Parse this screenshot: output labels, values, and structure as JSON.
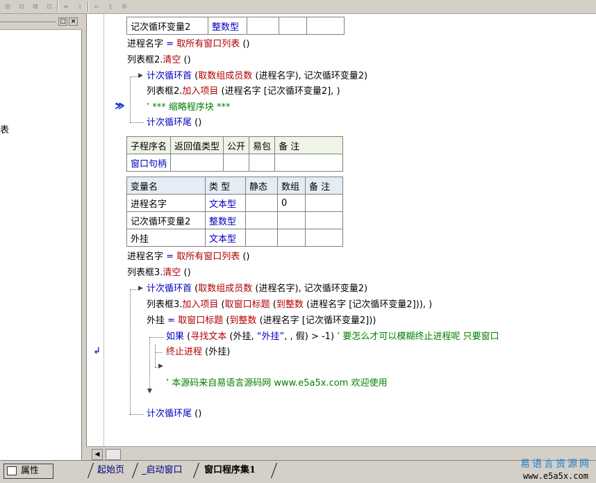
{
  "toolbar": {
    "icons": [
      "align-left-icon",
      "align-center-icon",
      "align-right-icon",
      "align-justify-icon",
      "distribute-h-icon",
      "distribute-v-icon",
      "same-width-icon",
      "same-height-icon",
      "same-size-icon"
    ]
  },
  "left_panel": {
    "pin_label": "□",
    "close_label": "×",
    "fragment": "表"
  },
  "margin": {
    "breakpoint_marker": "≫",
    "jump_marker": "↲"
  },
  "code": {
    "top_table": {
      "name": "记次循环变量2",
      "type": "整数型"
    },
    "l1": {
      "a": "进程名字",
      "b": " = ",
      "c": "取所有窗口列表",
      "d": " ()"
    },
    "l2": {
      "a": "列表框2.",
      "b": "清空",
      "c": " ()"
    },
    "l3": {
      "a": "计次循环首",
      "b": " (",
      "c": "取数组成员数",
      "d": " (进程名字), 记次循环变量2)"
    },
    "l4": {
      "a": "列表框2.",
      "b": "加入项目",
      "c": " (进程名字 [记次循环变量2], )"
    },
    "l5": {
      "a": "’ *** 缩略程序块 ***"
    },
    "l6": {
      "a": "计次循环尾",
      "b": " ()"
    },
    "sub_table": {
      "headers": [
        "子程序名",
        "返回值类型",
        "公开",
        "易包",
        "备 注"
      ],
      "row": [
        "窗口句柄",
        "",
        "",
        "",
        ""
      ]
    },
    "var_table": {
      "headers": [
        "变量名",
        "类 型",
        "静态",
        "数组",
        "备 注"
      ],
      "rows": [
        [
          "进程名字",
          "文本型",
          "",
          "0",
          ""
        ],
        [
          "记次循环变量2",
          "整数型",
          "",
          "",
          ""
        ],
        [
          "外挂",
          "文本型",
          "",
          "",
          ""
        ]
      ]
    },
    "l7": {
      "a": "进程名字",
      "b": " = ",
      "c": "取所有窗口列表",
      "d": " ()"
    },
    "l8": {
      "a": "列表框3.",
      "b": "清空",
      "c": " ()"
    },
    "l9": {
      "a": "计次循环首",
      "b": " (",
      "c": "取数组成员数",
      "d": " (进程名字), 记次循环变量2)"
    },
    "l10": {
      "a": "列表框3.",
      "b": "加入项目",
      "c": " (",
      "d": "取窗口标题",
      "e": " (",
      "f": "到整数",
      "g": " (进程名字 [记次循环变量2])), )"
    },
    "l11": {
      "a": "外挂",
      "b": " = ",
      "c": "取窗口标题",
      "d": " (",
      "e": "到整数",
      "f": " (进程名字 [记次循环变量2]))"
    },
    "l12": {
      "a": "如果",
      "b": " (",
      "c": "寻找文本",
      "d": " (外挂, ",
      "e": "“外挂”",
      "f": ", , 假) > -1) ",
      "g": "’ 要怎么才可以模糊终止进程呢 只要窗口"
    },
    "l13": {
      "a": "终止进程",
      "b": " (外挂)"
    },
    "l14": {
      "a": "’ 本源码来自易语言源码网 www.e5a5x.com  欢迎使用"
    },
    "l15": {
      "a": "计次循环尾",
      "b": " ()"
    }
  },
  "hscroll": {
    "left_arrow": "◀"
  },
  "bottom": {
    "properties_label": "属性",
    "tabs": [
      "起始页",
      "_启动窗口",
      "窗口程序集1"
    ]
  },
  "watermark": {
    "name": "易语言资源网",
    "url": "www.e5a5x.com"
  }
}
